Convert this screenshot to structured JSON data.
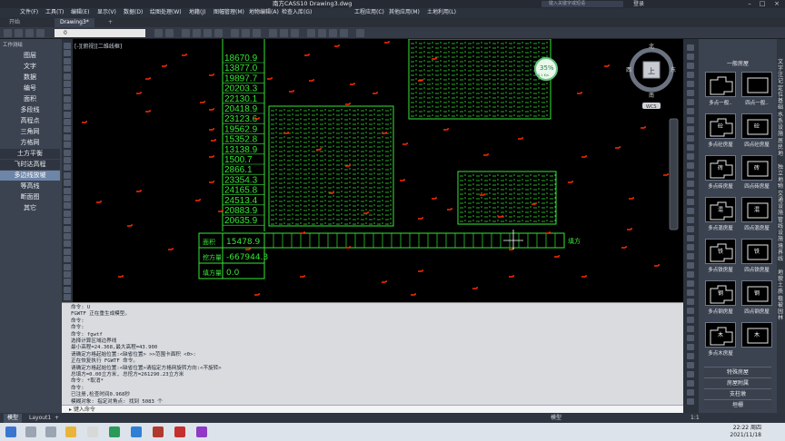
{
  "window": {
    "title": "南方CASS10    Drawing3.dwg",
    "search_placeholder": "键入关键字或短语",
    "user": "登录"
  },
  "menu": [
    "文件(F)",
    "工具(T)",
    "编辑(E)",
    "显示(V)",
    "数据(D)",
    "绘图处理(W)",
    "地籍(J)",
    "图幅管理(M)",
    "地物编辑(A)",
    "检查入库(G)",
    "工程应用(C)",
    "其他应用(M)",
    "土地利用(L)"
  ],
  "tabs": {
    "start": "开始",
    "drawing": "Drawing3*"
  },
  "toolbar": {
    "layer_value": "0"
  },
  "left_panel": {
    "title": "工作测绘",
    "items": [
      "图层",
      "文字",
      "数据",
      "编号",
      "面积",
      "多段线",
      "高程点",
      "三角网",
      "方格网",
      "土方平衡",
      "飞时达高程",
      "多边线放坡",
      "等高线",
      "断面图",
      "其它"
    ]
  },
  "viewport_label": "[-][俯视][二维线框]",
  "grid_numbers": [
    "18670.9",
    "13877.0",
    "19897.7",
    "20203.3",
    "22130.1",
    "20418.9",
    "23123.6",
    "19562.9",
    "15352.8",
    "13138.9",
    "1500.7",
    "2866.1",
    "23354.3",
    "24165.8",
    "24513.4",
    "20883.9",
    "20635.9"
  ],
  "summary_table": {
    "area_label": "面积",
    "area_value": "15478.9",
    "cut_label": "挖方量",
    "cut_value": "-667944.3",
    "fill_label": "填方量",
    "fill_value": "0.0",
    "fill_right_label": "填方"
  },
  "navigator": {
    "north": "北",
    "south": "南",
    "east": "东",
    "west": "西",
    "top": "上",
    "wcs": "WCS"
  },
  "zoom_badge": {
    "percent": "35%",
    "sub": "0.1 K/s"
  },
  "command_lines": [
    "命令: U",
    "FGWTF 正在重生成模型。",
    "命令:",
    "命令:",
    "命令: fgwtf",
    "选择计算区域边界线",
    "最小高程=24.368,最大高程=43.900",
    "请确定方格起始位置:<缺省位置> >>范围卡面积 <0>:",
    "正在恢复执行 FGWTF 命令。",
    "请确定方格起始位置:<缺省位置>请指定方格网旋转方向:<不旋转>",
    "总填方=0.00立方米, 总挖方=261290.23立方米",
    "命令: *取消*",
    "命令:",
    "已注册,检查时间0.968秒",
    "模糊对象: 指定对角点: 找到 5083 个",
    "模糊对象:"
  ],
  "command_prompt": "键入命令",
  "right_panel": {
    "title": "一般房屋",
    "symbols": [
      {
        "label": "多点一般..",
        "inner": ""
      },
      {
        "label": "四点一般..",
        "inner": ""
      },
      {
        "label": "多点砼房屋",
        "inner": "砼"
      },
      {
        "label": "四点砼房屋",
        "inner": "砼"
      },
      {
        "label": "多点砖房屋",
        "inner": "砖"
      },
      {
        "label": "四点砖房屋",
        "inner": "砖"
      },
      {
        "label": "多点混房屋",
        "inner": "混"
      },
      {
        "label": "四点混房屋",
        "inner": "混"
      },
      {
        "label": "多点铁房屋",
        "inner": "铁"
      },
      {
        "label": "四点铁房屋",
        "inner": "铁"
      },
      {
        "label": "多点钢房屋",
        "inner": "钢"
      },
      {
        "label": "四点钢房屋",
        "inner": "钢"
      },
      {
        "label": "多点木房屋",
        "inner": "木"
      },
      {
        "label": "",
        "inner": "木"
      }
    ],
    "buttons": [
      "特殊房屋",
      "房屋附属",
      "支柱墩",
      "垣栅"
    ]
  },
  "far_right_text": [
    "文字注记",
    "定位基础",
    "水系设施",
    "居民地",
    "独立地物",
    "交通设施",
    "管线设施",
    "境界线",
    "地貌土质",
    "植被园林"
  ],
  "status": {
    "tabs": [
      "模型",
      "Layout1"
    ],
    "mode": "模型",
    "scale": "1:1"
  },
  "taskbar": {
    "time": "22:22 周四",
    "date": "2021/11/18"
  },
  "colors": {
    "grid": "#36e636",
    "points": "#ff2a00",
    "text_yellow": "#ffff66",
    "accent": "#6d85a8"
  }
}
